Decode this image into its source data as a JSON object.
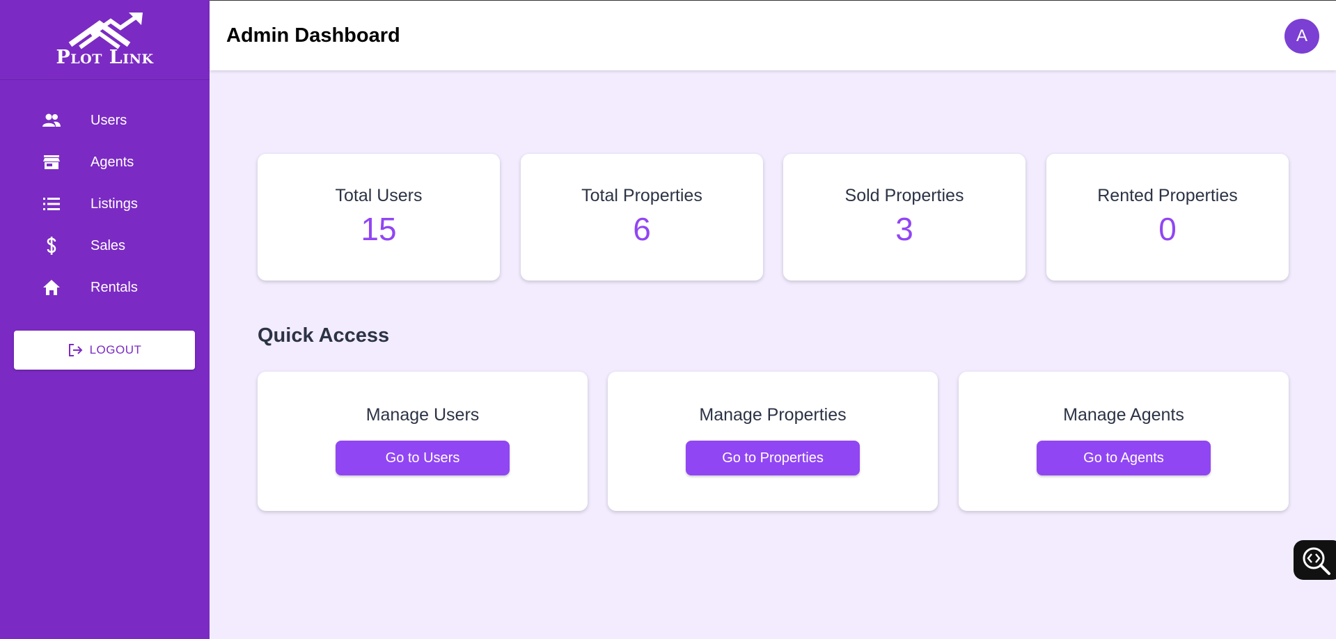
{
  "sidebar": {
    "logo_text": "Plot Link",
    "items": [
      {
        "label": "Users",
        "icon": "users-icon"
      },
      {
        "label": "Agents",
        "icon": "store-icon"
      },
      {
        "label": "Listings",
        "icon": "list-icon"
      },
      {
        "label": "Sales",
        "icon": "dollar-icon"
      },
      {
        "label": "Rentals",
        "icon": "home-icon"
      }
    ],
    "logout_label": "LOGOUT"
  },
  "header": {
    "title": "Admin Dashboard",
    "avatar_initial": "A"
  },
  "stats": [
    {
      "label": "Total Users",
      "value": "15"
    },
    {
      "label": "Total Properties",
      "value": "6"
    },
    {
      "label": "Sold Properties",
      "value": "3"
    },
    {
      "label": "Rented Properties",
      "value": "0"
    }
  ],
  "quick_access": {
    "title": "Quick Access",
    "cards": [
      {
        "label": "Manage Users",
        "button": "Go to Users"
      },
      {
        "label": "Manage Properties",
        "button": "Go to Properties"
      },
      {
        "label": "Manage Agents",
        "button": "Go to Agents"
      }
    ]
  },
  "colors": {
    "sidebar": "#7b2bc3",
    "accent": "#9146f3",
    "background": "#f2ecfe"
  }
}
